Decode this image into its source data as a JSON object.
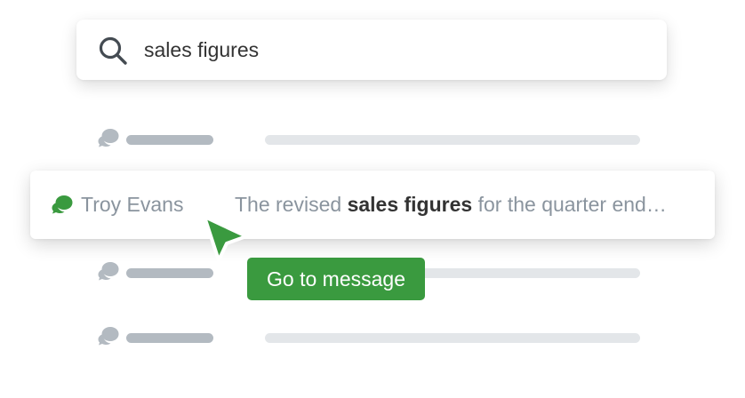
{
  "search": {
    "query": "sales figures",
    "icon": "search-icon"
  },
  "result": {
    "sender": "Troy Evans",
    "snippet_before": "The revised ",
    "snippet_highlight": "sales figures",
    "snippet_after": " for the quarter end…",
    "icon": "chat-bubble-icon"
  },
  "action": {
    "label": "Go to message"
  },
  "colors": {
    "accent_green": "#3a9a3f",
    "placeholder_name": "#b3bac1",
    "placeholder_text": "#e3e6e9",
    "muted_text": "#8a949e",
    "highlight_text": "#333333"
  }
}
